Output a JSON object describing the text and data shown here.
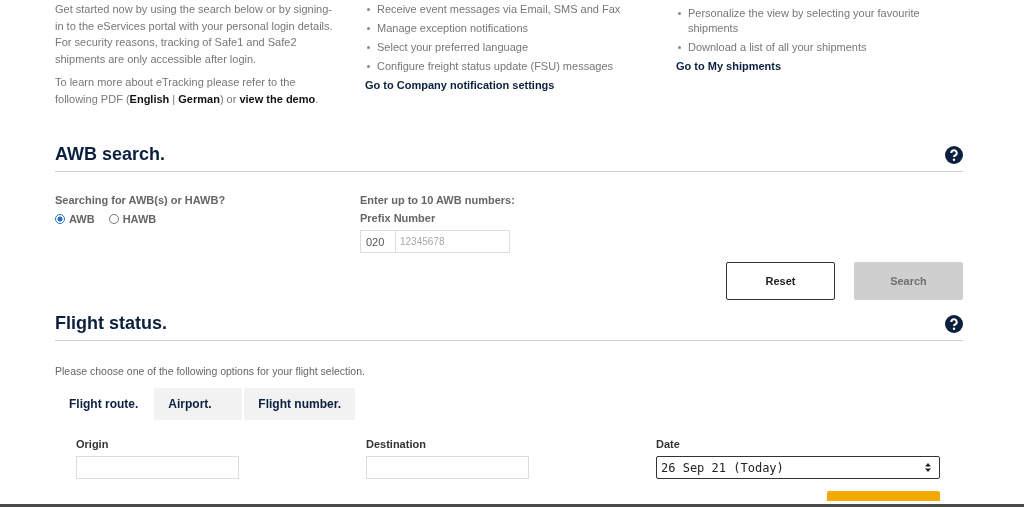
{
  "intro": {
    "paragraphs": [
      "Get started now by using the search below or by signing-in to the eServices portal with your personal login details. For security reasons, tracking of Safe1 and Safe2 shipments are only accessible after login."
    ],
    "learn_more": {
      "before": "To learn more about eTracking please refer to the following PDF (",
      "link_1": "English",
      "separator": " | ",
      "link_2": "German",
      "middle": ")  or ",
      "link_3": "view the demo",
      "after": "."
    }
  },
  "notifications": {
    "items": [
      "Receive event messages via Email, SMS and Fax",
      "Manage exception notifications",
      "Select your preferred language",
      "Configure freight status update (FSU) messages"
    ],
    "link": "Go to Company notification settings"
  },
  "shipments": {
    "items": [
      "Personalize the view by selecting your favourite shipments",
      "Download a list of all your shipments"
    ],
    "link": "Go to My shipments"
  },
  "awb_search": {
    "title": "AWB search.",
    "question": "Searching for AWB(s) or HAWB?",
    "options": [
      {
        "label": "AWB",
        "selected": true
      },
      {
        "label": "HAWB",
        "selected": false
      }
    ],
    "numbers_label": "Enter up to 10 AWB numbers:",
    "prefix_label": "Prefix Number",
    "prefix": "020",
    "number_placeholder": "12345678",
    "buttons": [
      {
        "label": "Reset",
        "disabled": false
      },
      {
        "label": "Search",
        "disabled": true
      }
    ]
  },
  "flight_status": {
    "title": "Flight status.",
    "hint": "Please choose one of the following options for your flight selection.",
    "tabs": [
      {
        "label": "Flight route.",
        "selected": true
      },
      {
        "label": "Airport.",
        "selected": false
      },
      {
        "label": "Flight number.",
        "selected": false
      }
    ],
    "origin_label": "Origin",
    "destination_label": "Destination",
    "date_label": "Date",
    "date": "26 Sep 21 (Today)"
  }
}
